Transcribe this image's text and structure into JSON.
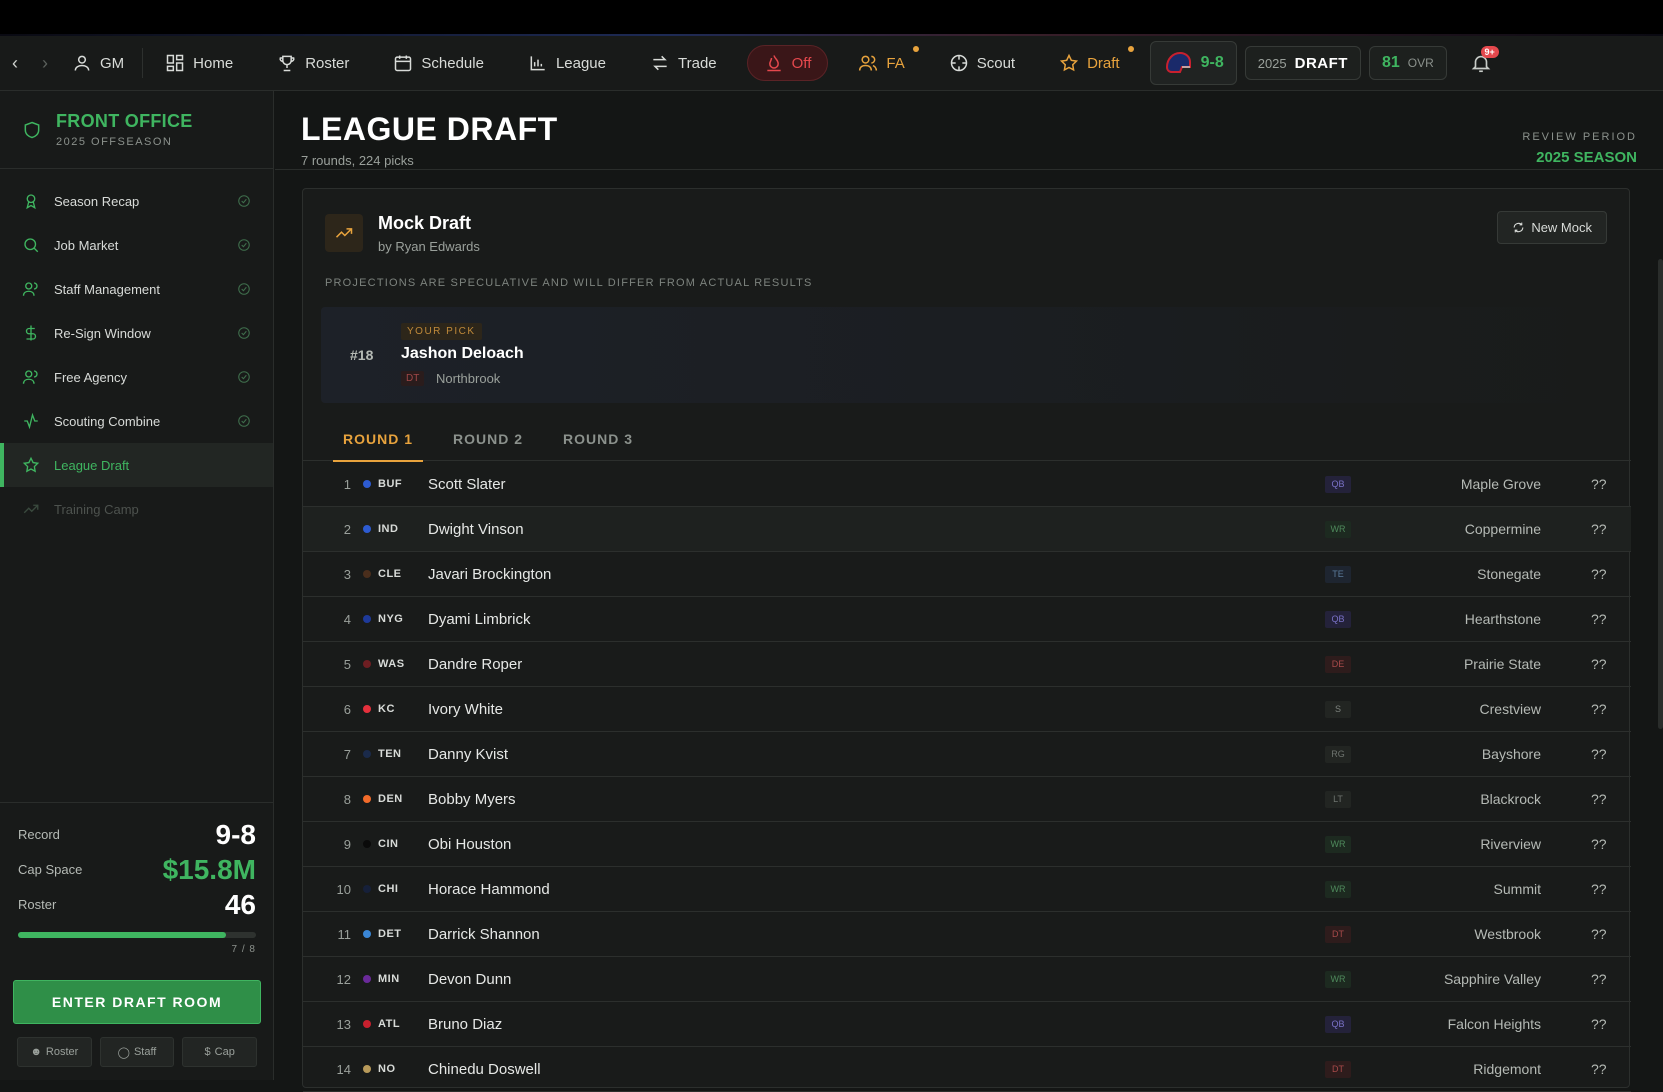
{
  "nav": {
    "gm": "GM",
    "items": [
      {
        "label": "Home",
        "icon": "grid-icon"
      },
      {
        "label": "Roster",
        "icon": "trophy-icon"
      },
      {
        "label": "Schedule",
        "icon": "calendar-icon"
      },
      {
        "label": "League",
        "icon": "bar-chart-icon"
      },
      {
        "label": "Trade",
        "icon": "swap-icon"
      }
    ],
    "off": "Off",
    "fa": "FA",
    "scout": "Scout",
    "draft": "Draft",
    "team_record": "9-8",
    "draft_year": "2025",
    "draft_label": "DRAFT",
    "ovr_num": "81",
    "ovr_label": "OVR",
    "notif_badge": "9+"
  },
  "sidebar": {
    "title": "FRONT OFFICE",
    "subtitle": "2025 OFFSEASON",
    "items": [
      {
        "label": "Season Recap"
      },
      {
        "label": "Job Market"
      },
      {
        "label": "Staff Management"
      },
      {
        "label": "Re-Sign Window"
      },
      {
        "label": "Free Agency"
      },
      {
        "label": "Scouting Combine"
      },
      {
        "label": "League Draft"
      },
      {
        "label": "Training Camp"
      }
    ],
    "stats": {
      "record_label": "Record",
      "record": "9-8",
      "cap_label": "Cap Space",
      "cap": "$15.8M",
      "roster_label": "Roster",
      "roster": "46",
      "progress": 0.875,
      "progress_label": "7 / 8"
    },
    "enter_button": "ENTER DRAFT ROOM",
    "mini_buttons": [
      "Roster",
      "Staff",
      "Cap"
    ]
  },
  "main": {
    "title": "LEAGUE DRAFT",
    "subtitle": "7 rounds, 224 picks",
    "period_label": "REVIEW PERIOD",
    "period_value": "2025 SEASON",
    "mock": {
      "title": "Mock Draft",
      "by": "by Ryan Edwards",
      "new_button": "New Mock",
      "disclaimer": "PROJECTIONS ARE SPECULATIVE AND WILL DIFFER FROM ACTUAL RESULTS"
    },
    "your_pick": {
      "number": "#18",
      "tag": "YOUR PICK",
      "name": "Jashon Deloach",
      "pos": "DT",
      "school": "Northbrook"
    },
    "tabs": [
      "ROUND 1",
      "ROUND 2",
      "ROUND 3"
    ],
    "picks": [
      {
        "n": "1",
        "team": "BUF",
        "color": "#2d5bd1",
        "name": "Scott Slater",
        "pos": "QB",
        "school": "Maple Grove",
        "grade": "??"
      },
      {
        "n": "2",
        "team": "IND",
        "color": "#2d5bd1",
        "name": "Dwight Vinson",
        "pos": "WR",
        "school": "Coppermine",
        "grade": "??"
      },
      {
        "n": "3",
        "team": "CLE",
        "color": "#4a2e1c",
        "name": "Javari Brockington",
        "pos": "TE",
        "school": "Stonegate",
        "grade": "??"
      },
      {
        "n": "4",
        "team": "NYG",
        "color": "#1e3a9a",
        "name": "Dyami Limbrick",
        "pos": "QB",
        "school": "Hearthstone",
        "grade": "??"
      },
      {
        "n": "5",
        "team": "WAS",
        "color": "#6e1e22",
        "name": "Dandre Roper",
        "pos": "DE",
        "school": "Prairie State",
        "grade": "??"
      },
      {
        "n": "6",
        "team": "KC",
        "color": "#e5303c",
        "name": "Ivory White",
        "pos": "S",
        "school": "Crestview",
        "grade": "??"
      },
      {
        "n": "7",
        "team": "TEN",
        "color": "#1a2a4a",
        "name": "Danny Kvist",
        "pos": "RG",
        "school": "Bayshore",
        "grade": "??"
      },
      {
        "n": "8",
        "team": "DEN",
        "color": "#f26b2a",
        "name": "Bobby Myers",
        "pos": "LT",
        "school": "Blackrock",
        "grade": "??"
      },
      {
        "n": "9",
        "team": "CIN",
        "color": "#0a0a0a",
        "name": "Obi Houston",
        "pos": "WR",
        "school": "Riverview",
        "grade": "??"
      },
      {
        "n": "10",
        "team": "CHI",
        "color": "#16203a",
        "name": "Horace Hammond",
        "pos": "WR",
        "school": "Summit",
        "grade": "??"
      },
      {
        "n": "11",
        "team": "DET",
        "color": "#3a86d6",
        "name": "Darrick Shannon",
        "pos": "DT",
        "school": "Westbrook",
        "grade": "??"
      },
      {
        "n": "12",
        "team": "MIN",
        "color": "#6a2a9a",
        "name": "Devon Dunn",
        "pos": "WR",
        "school": "Sapphire Valley",
        "grade": "??"
      },
      {
        "n": "13",
        "team": "ATL",
        "color": "#c8202e",
        "name": "Bruno Diaz",
        "pos": "QB",
        "school": "Falcon Heights",
        "grade": "??"
      },
      {
        "n": "14",
        "team": "NO",
        "color": "#b89a5a",
        "name": "Chinedu Doswell",
        "pos": "DT",
        "school": "Ridgemont",
        "grade": "??"
      }
    ]
  },
  "pos_colors": {
    "QB": {
      "bg": "#24223a",
      "fg": "#7a72c8"
    },
    "WR": {
      "bg": "#1d2a20",
      "fg": "#4f8a5c"
    },
    "TE": {
      "bg": "#1e2530",
      "fg": "#5a7a9a"
    },
    "DE": {
      "bg": "#2e1c1c",
      "fg": "#a84a4a"
    },
    "DT": {
      "bg": "#2e1c1c",
      "fg": "#a84a4a"
    },
    "S": {
      "bg": "#222522",
      "fg": "#7d837e"
    },
    "RG": {
      "bg": "#222522",
      "fg": "#6d736e"
    },
    "LT": {
      "bg": "#222522",
      "fg": "#6d736e"
    }
  }
}
